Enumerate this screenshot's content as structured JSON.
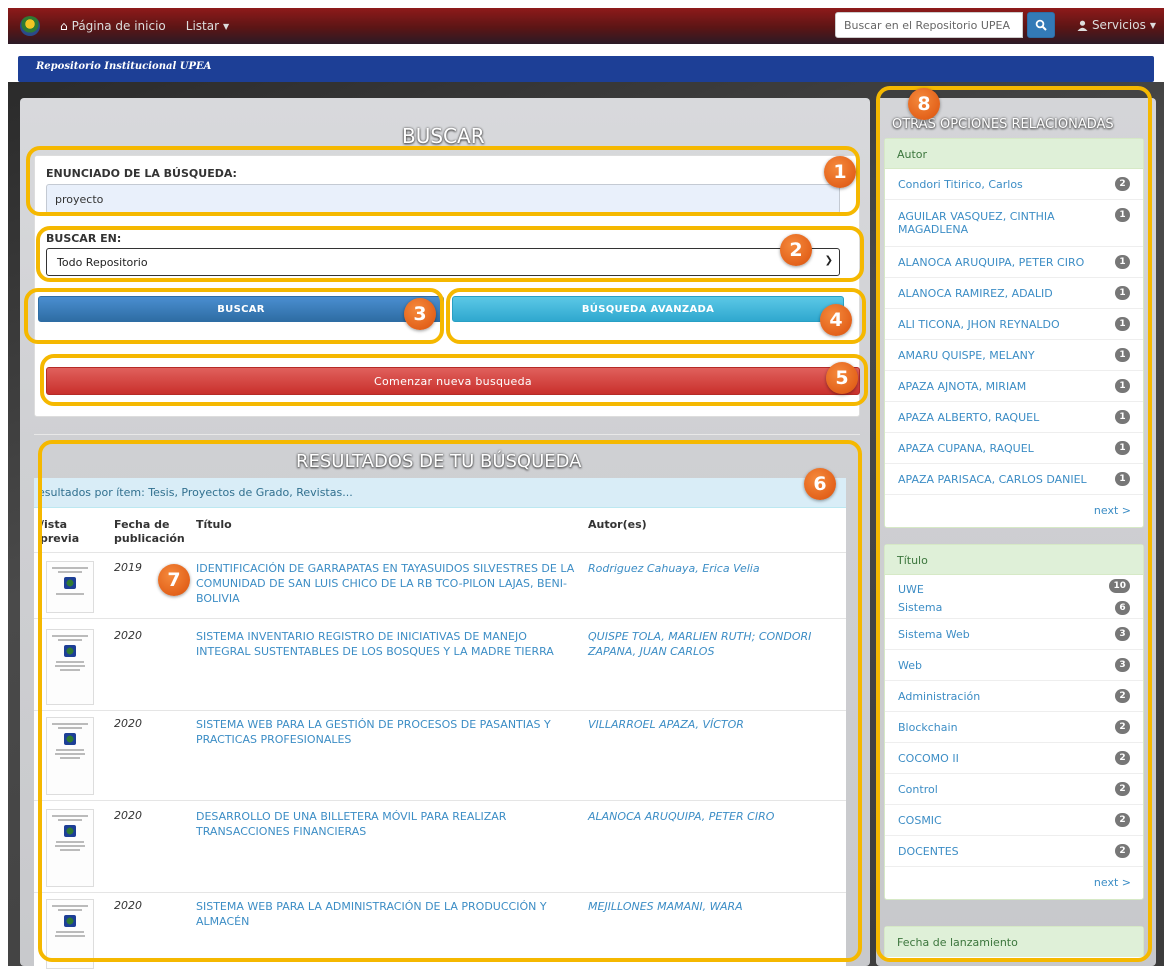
{
  "navbar": {
    "home_label": "Página de inicio",
    "browse_label": "Listar",
    "search_placeholder": "Buscar en el Repositorio UPEA",
    "services_label": "Servicios"
  },
  "strip": {
    "title": "Repositorio Institucional UPEA"
  },
  "search": {
    "heading": "BUSCAR",
    "query_label": "ENUNCIADO DE LA BÚSQUEDA:",
    "query_value": "proyecto",
    "scope_label": "BUSCAR EN:",
    "scope_value": "Todo Repositorio",
    "search_button": "BUSCAR",
    "advanced_button": "BÚSQUEDA AVANZADA",
    "new_search_button": "Comenzar nueva busqueda"
  },
  "results": {
    "heading": "RESULTADOS DE TU BÚSQUEDA",
    "header_text": "esultados por ítem: Tesis, Proyectos de Grado, Revistas...",
    "col_preview": "/ista\nprevia",
    "col_date": "Fecha de\npublicación",
    "col_title": "Título",
    "col_authors": "Autor(es)",
    "rows": [
      {
        "year": "2019",
        "title": "IDENTIFICACIÓN DE GARRAPATAS EN TAYASUIDOS SILVESTRES DE LA COMUNIDAD DE SAN LUIS CHICO DE LA RB TCO-PILON LAJAS, BENI-BOLIVIA",
        "authors": "Rodriguez Cahuaya, Erica Velia"
      },
      {
        "year": "2020",
        "title": "SISTEMA INVENTARIO REGISTRO DE INICIATIVAS DE MANEJO INTEGRAL SUSTENTABLES DE LOS BOSQUES Y LA MADRE TIERRA",
        "authors": "QUISPE TOLA, MARLIEN RUTH; CONDORI ZAPANA, JUAN CARLOS"
      },
      {
        "year": "2020",
        "title": "SISTEMA WEB PARA LA GESTIÓN DE PROCESOS DE PASANTIAS Y PRACTICAS PROFESIONALES",
        "authors": "VILLARROEL APAZA, VÍCTOR"
      },
      {
        "year": "2020",
        "title": "DESARROLLO DE UNA BILLETERA MÓVIL PARA REALIZAR TRANSACCIONES FINANCIERAS",
        "authors": "ALANOCA ARUQUIPA, PETER CIRO"
      },
      {
        "year": "2020",
        "title": "SISTEMA WEB PARA LA ADMINISTRACIÓN DE LA PRODUCCIÓN Y ALMACÉN",
        "authors": "MEJILLONES MAMANI, WARA"
      }
    ]
  },
  "sidebar": {
    "heading": "OTRAS OPCIONES RELACIONADAS",
    "author_facet": {
      "title": "Autor",
      "items": [
        {
          "label": "Condori Titirico, Carlos",
          "count": "2"
        },
        {
          "label": "AGUILAR VASQUEZ, CINTHIA MAGADLENA",
          "count": "1"
        },
        {
          "label": "ALANOCA ARUQUIPA, PETER CIRO",
          "count": "1"
        },
        {
          "label": "ALANOCA RAMIREZ, ADALID",
          "count": "1"
        },
        {
          "label": "ALI TICONA, JHON REYNALDO",
          "count": "1"
        },
        {
          "label": "AMARU QUISPE, MELANY",
          "count": "1"
        },
        {
          "label": "APAZA AJNOTA, MIRIAM",
          "count": "1"
        },
        {
          "label": "APAZA ALBERTO, RAQUEL",
          "count": "1"
        },
        {
          "label": "APAZA CUPANA, RAQUEL",
          "count": "1"
        },
        {
          "label": "APAZA PARISACA, CARLOS DANIEL",
          "count": "1"
        }
      ],
      "next": "next >"
    },
    "title_facet": {
      "title": "Título",
      "items": [
        {
          "label": "UWE",
          "count": "10"
        },
        {
          "label": "Sistema",
          "count": "6"
        },
        {
          "label": "Sistema Web",
          "count": "3"
        },
        {
          "label": "Web",
          "count": "3"
        },
        {
          "label": "Administración",
          "count": "2"
        },
        {
          "label": "Blockchain",
          "count": "2"
        },
        {
          "label": "COCOMO II",
          "count": "2"
        },
        {
          "label": "Control",
          "count": "2"
        },
        {
          "label": "COSMIC",
          "count": "2"
        },
        {
          "label": "DOCENTES",
          "count": "2"
        }
      ],
      "next": "next >"
    },
    "date_facet": {
      "title": "Fecha de lanzamiento"
    }
  },
  "callouts": [
    "1",
    "2",
    "3",
    "4",
    "5",
    "6",
    "7",
    "8"
  ],
  "colors": {
    "highlight": "#f5b800",
    "marker": "#e3621b",
    "brand_blue": "#1d3f96",
    "navbar_red": "#8e1a1a"
  }
}
